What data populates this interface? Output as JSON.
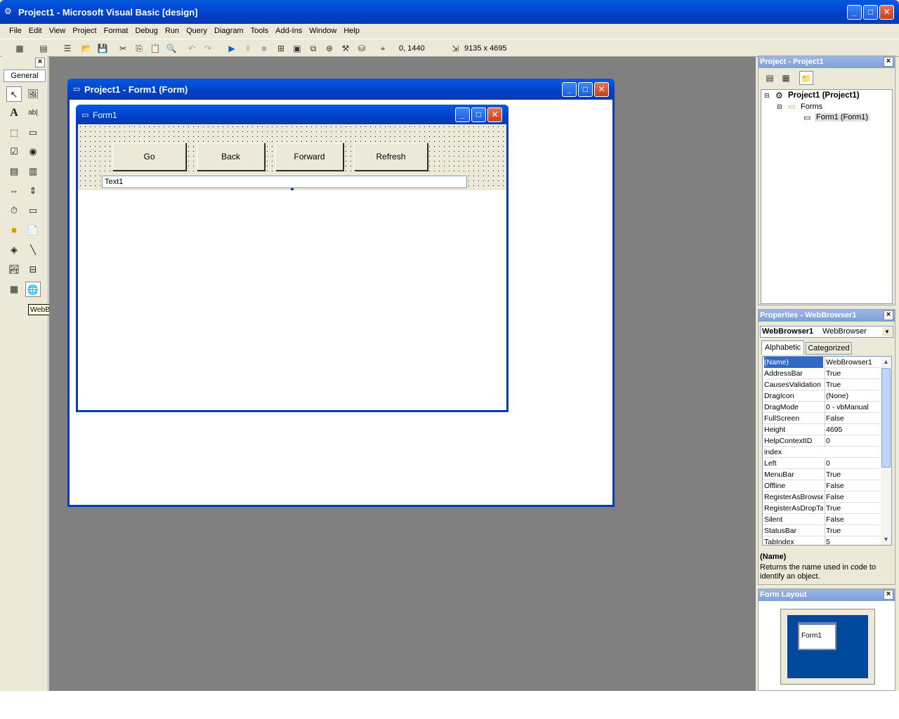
{
  "app": {
    "title": "Project1 - Microsoft Visual Basic [design]"
  },
  "menu": [
    "File",
    "Edit",
    "View",
    "Project",
    "Format",
    "Debug",
    "Run",
    "Query",
    "Diagram",
    "Tools",
    "Add-Ins",
    "Window",
    "Help"
  ],
  "toolbar": {
    "position": "0, 1440",
    "size": "9135 x 4695"
  },
  "toolbox": {
    "tab": "General",
    "tooltip": "WebBrowser"
  },
  "designer": {
    "title": "Project1 - Form1 (Form)"
  },
  "form": {
    "title": "Form1",
    "buttons": [
      "Go",
      "Back",
      "Forward",
      "Refresh"
    ],
    "textbox": "Text1"
  },
  "project": {
    "header": "Project - Project1",
    "root": "Project1 (Project1)",
    "folder": "Forms",
    "item": "Form1 (Form1)"
  },
  "properties": {
    "header": "Properties - WebBrowser1",
    "object_name": "WebBrowser1",
    "object_type": "WebBrowser",
    "tab_alpha": "Alphabetic",
    "tab_cat": "Categorized",
    "rows": [
      {
        "n": "(Name)",
        "v": "WebBrowser1"
      },
      {
        "n": "AddressBar",
        "v": "True"
      },
      {
        "n": "CausesValidation",
        "v": "True"
      },
      {
        "n": "DragIcon",
        "v": "(None)"
      },
      {
        "n": "DragMode",
        "v": "0 - vbManual"
      },
      {
        "n": "FullScreen",
        "v": "False"
      },
      {
        "n": "Height",
        "v": "4695"
      },
      {
        "n": "HelpContextID",
        "v": "0"
      },
      {
        "n": "index",
        "v": ""
      },
      {
        "n": "Left",
        "v": "0"
      },
      {
        "n": "MenuBar",
        "v": "True"
      },
      {
        "n": "Offline",
        "v": "False"
      },
      {
        "n": "RegisterAsBrowser",
        "v": "False"
      },
      {
        "n": "RegisterAsDropTarget",
        "v": "True"
      },
      {
        "n": "Silent",
        "v": "False"
      },
      {
        "n": "StatusBar",
        "v": "True"
      },
      {
        "n": "TabIndex",
        "v": "5"
      }
    ],
    "desc_title": "(Name)",
    "desc_text": "Returns the name used in code to identify an object."
  },
  "layout": {
    "header": "Form Layout",
    "form_label": "Form1"
  },
  "colors": {
    "mdi_bg": "#808080",
    "title_blue": "#0053e0",
    "selected_row": "#316ac5"
  }
}
